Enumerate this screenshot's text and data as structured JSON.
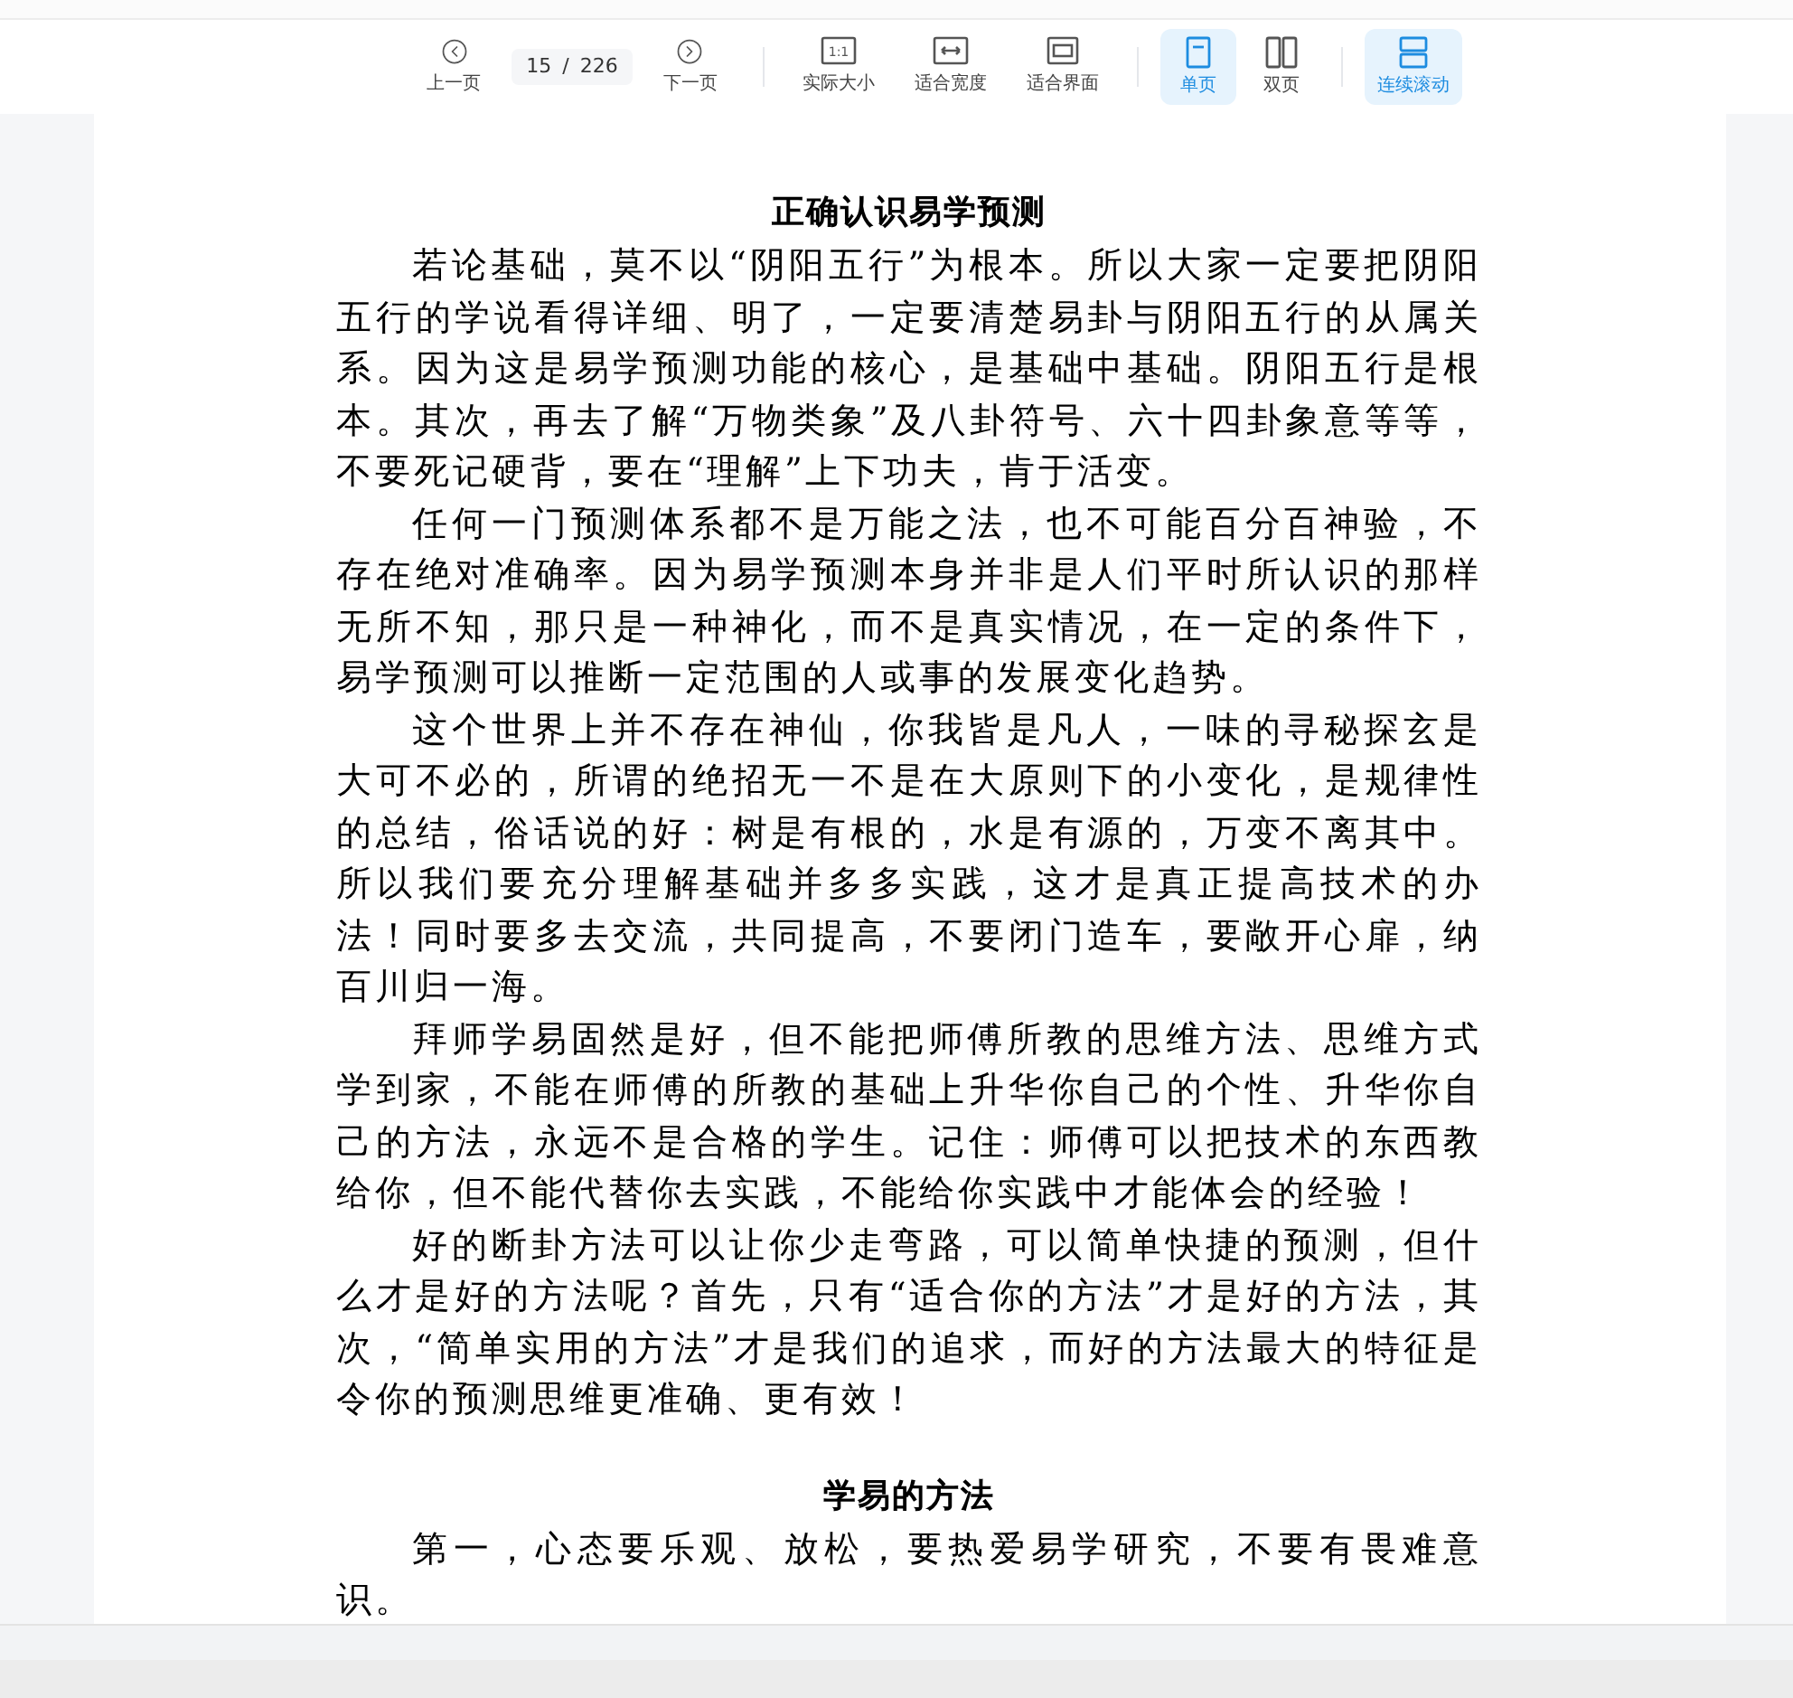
{
  "toolbar": {
    "prev_page": {
      "label": "上一页"
    },
    "page_indicator": {
      "current": "15",
      "separator": "/",
      "total": "226"
    },
    "next_page": {
      "label": "下一页"
    },
    "zoom_buttons": [
      {
        "kind": "actual",
        "label": "实际大小",
        "icon_text": "1:1"
      },
      {
        "kind": "width",
        "label": "适合宽度"
      },
      {
        "kind": "fit",
        "label": "适合界面"
      }
    ],
    "view_modes": [
      {
        "kind": "single",
        "label": "单页",
        "selected": true
      },
      {
        "kind": "double",
        "label": "双页",
        "selected": false
      }
    ],
    "continuous_scroll": {
      "label": "连续滚动",
      "on": true
    }
  },
  "document": {
    "sections": [
      {
        "heading": "正确认识易学预测",
        "paragraphs": [
          "若论基础，莫不以“阴阳五行”为根本。所以大家一定要把阴阳五行的学说看得详细、明了，一定要清楚易卦与阴阳五行的从属关系。因为这是易学预测功能的核心，是基础中基础。阴阳五行是根本。其次，再去了解“万物类象”及八卦符号、六十四卦象意等等，不要死记硬背，要在“理解”上下功夫，肯于活变。",
          "任何一门预测体系都不是万能之法，也不可能百分百神验，不存在绝对准确率。因为易学预测本身并非是人们平时所认识的那样无所不知，那只是一种神化，而不是真实情况，在一定的条件下，易学预测可以推断一定范围的人或事的发展变化趋势。",
          "这个世界上并不存在神仙，你我皆是凡人，一味的寻秘探玄是大可不必的，所谓的绝招无一不是在大原则下的小变化，是规律性的总结，俗话说的好：树是有根的，水是有源的，万变不离其中。所以我们要充分理解基础并多多实践，这才是真正提高技术的办法！同时要多去交流，共同提高，不要闭门造车，要敞开心扉，纳百川归一海。",
          "拜师学易固然是好，但不能把师傅所教的思维方法、思维方式学到家，不能在师傅的所教的基础上升华你自己的个性、升华你自己的方法，永远不是合格的学生。记住：师傅可以把技术的东西教给你，但不能代替你去实践，不能给你实践中才能体会的经验！",
          "好的断卦方法可以让你少走弯路，可以简单快捷的预测，但什么才是好的方法呢？首先，只有“适合你的方法”才是好的方法，其次，“简单实用的方法”才是我们的追求，而好的方法最大的特征是令你的预测思维更准确、更有效！"
        ]
      },
      {
        "heading": "学易的方法",
        "paragraphs": [
          "第一，心态要乐观、放松，要热爱易学研究，不要有畏难意识。"
        ]
      }
    ]
  }
}
